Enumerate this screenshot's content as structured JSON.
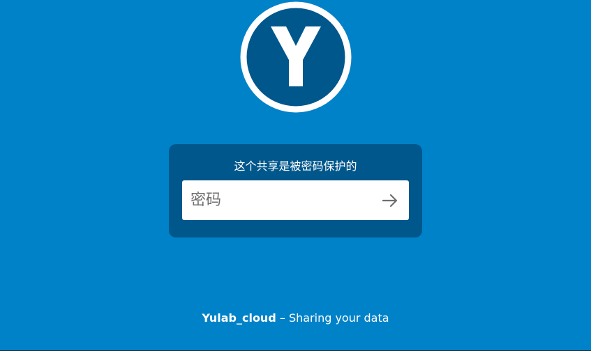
{
  "brand": {
    "logo_icon": "yulab-y-logo-icon",
    "logo_letter": "Y",
    "colors": {
      "background": "#0082c9",
      "panel": "#00578c",
      "logo_fill": "#00578c",
      "logo_ring": "#ffffff"
    }
  },
  "login": {
    "prompt": "这个共享是被密码保护的",
    "password_placeholder": "密码",
    "submit_icon": "arrow-right-icon"
  },
  "footer": {
    "brand_name": "Yulab_cloud",
    "separator": " – ",
    "tagline": "Sharing your data"
  }
}
